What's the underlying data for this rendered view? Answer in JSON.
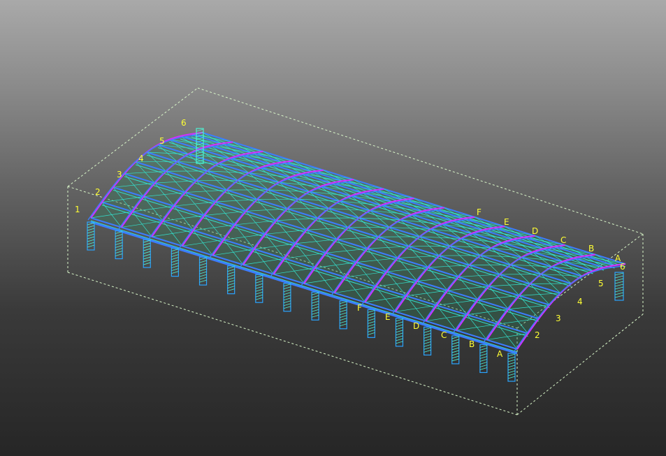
{
  "colors": {
    "background_top": "#a9a9a9",
    "background_bottom": "#262626",
    "bounding_box": "#d8f5c8",
    "column": "#2aa4ff",
    "column_hatch": "#4ff0d0",
    "arch": "#cc33ff",
    "purlin": "#3c7dff",
    "bracing": "#33e0cc",
    "roof_fill": "#2a7a5a",
    "label": "#ffff33"
  },
  "labels": {
    "arch_axes_left": [
      "1",
      "2",
      "3",
      "4",
      "5",
      "6"
    ],
    "arch_axes_right": [
      "6",
      "5",
      "4",
      "3",
      "2"
    ],
    "longitudinal_axes_far": [
      "F",
      "E",
      "D",
      "C",
      "B",
      "A"
    ],
    "longitudinal_axes_near": [
      "F",
      "E",
      "D",
      "C",
      "B",
      "A"
    ]
  }
}
